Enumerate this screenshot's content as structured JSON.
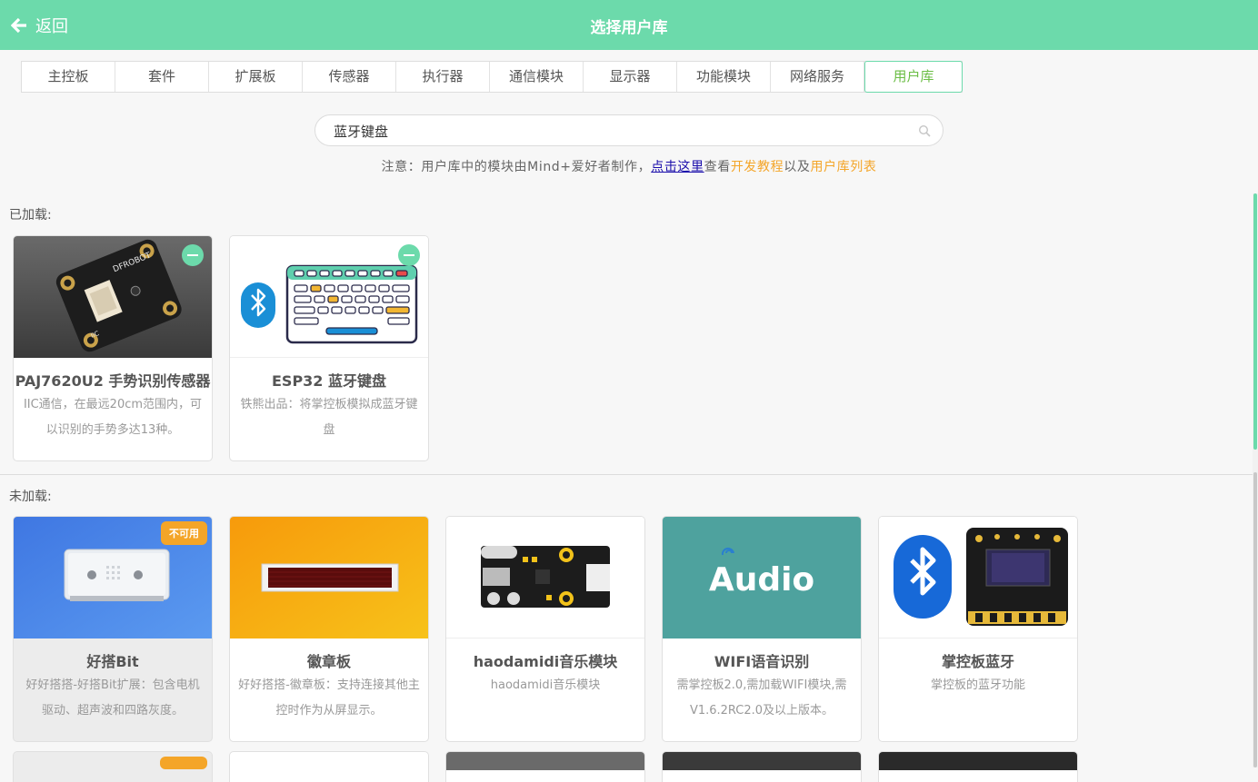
{
  "header": {
    "back_label": "返回",
    "title": "选择用户库"
  },
  "tabs": [
    {
      "label": "主控板"
    },
    {
      "label": "套件"
    },
    {
      "label": "扩展板"
    },
    {
      "label": "传感器"
    },
    {
      "label": "执行器"
    },
    {
      "label": "通信模块"
    },
    {
      "label": "显示器"
    },
    {
      "label": "功能模块"
    },
    {
      "label": "网络服务"
    },
    {
      "label": "用户库",
      "active": true
    }
  ],
  "search": {
    "value": "蓝牙键盘"
  },
  "notice": {
    "prefix": "注意：用户库中的模块由Mind+爱好者制作，",
    "link": "点击这里",
    "mid1": "查看",
    "dev_tutorial": "开发教程",
    "mid2": "以及",
    "lib_list": "用户库列表"
  },
  "loaded": {
    "label": "已加载:",
    "cards": [
      {
        "name": "PAJ7620U2 手势识别传感器",
        "desc": "IIC通信，在最远20cm范围内，可以识别的手势多达13种。",
        "image": "gravity-sensor-board"
      },
      {
        "name": "ESP32 蓝牙键盘",
        "desc": "铁熊出品：将掌控板模拟成蓝牙键盘",
        "image": "bluetooth-keyboard"
      }
    ]
  },
  "unloaded": {
    "label": "未加载:",
    "unavailable_badge": "不可用",
    "cards": [
      {
        "name": "好搭Bit",
        "desc": "好好搭搭-好搭Bit扩展：包含电机驱动、超声波和四路灰度。",
        "image": "haodabit-board",
        "unavailable": true
      },
      {
        "name": "徽章板",
        "desc": "好好搭搭-徽章板：支持连接其他主控时作为从屏显示。",
        "image": "badge-led-board"
      },
      {
        "name": "haodamidi音乐模块",
        "desc": "haodamidi音乐模块",
        "image": "midi-module"
      },
      {
        "name": "WIFI语音识别",
        "desc": "需掌控板2.0,需加载WIFI模块,需V1.6.2RC2.0及以上版本。",
        "image": "audio-logo",
        "image_text": "Audio"
      },
      {
        "name": "掌控板蓝牙",
        "desc": "掌控板的蓝牙功能",
        "image": "bluetooth-handpy"
      }
    ]
  },
  "colors": {
    "accent": "#6cdaab",
    "orange": "#f4a528",
    "link": "#1a0dab",
    "active_tab_text": "#6bbd45"
  }
}
